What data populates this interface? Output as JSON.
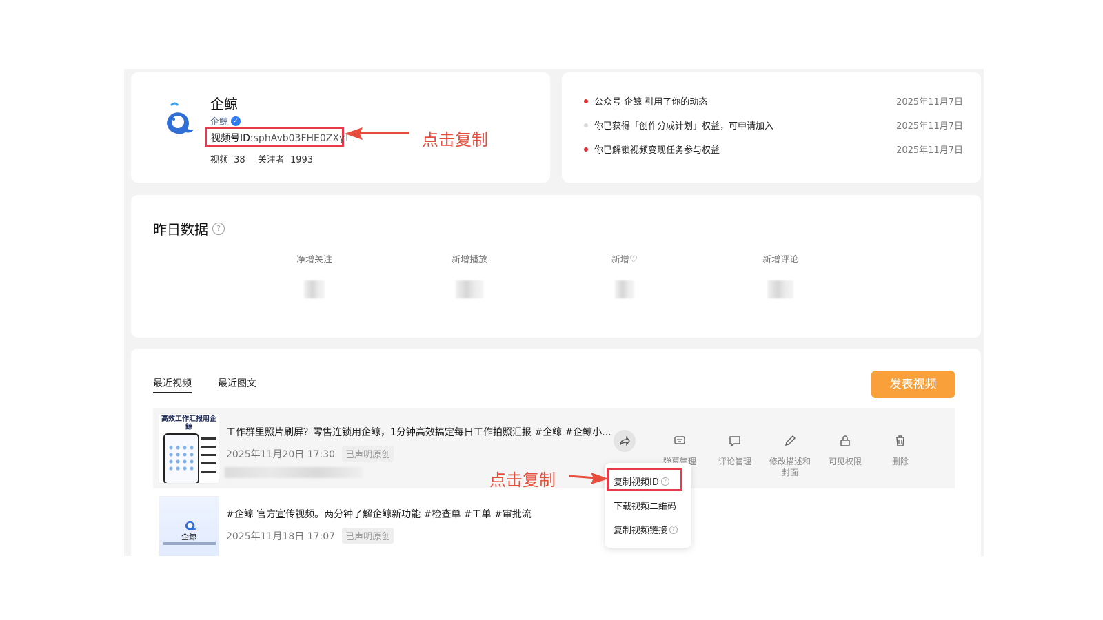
{
  "profile": {
    "name": "企鲸",
    "sub_name": "企鲸",
    "id_label": "视频号ID:",
    "id_value": "sphAvb03FHE0ZXy",
    "videos_label": "视频",
    "videos_count": "38",
    "followers_label": "关注者",
    "followers_count": "1993"
  },
  "notices": [
    {
      "text": "公众号 企鲸 引用了你的动态",
      "date": "2025年11月7日",
      "unread": true
    },
    {
      "text": "你已获得「创作分成计划」权益，可申请加入",
      "date": "2025年11月7日",
      "unread": false
    },
    {
      "text": "你已解锁视频变现任务参与权益",
      "date": "2025年11月7日",
      "unread": true
    }
  ],
  "stats": {
    "title": "昨日数据",
    "items": [
      {
        "label": "净增关注"
      },
      {
        "label": "新增播放"
      },
      {
        "label": "新增"
      },
      {
        "label": "新增评论"
      }
    ]
  },
  "videos_section": {
    "tabs": [
      "最近视频",
      "最近图文"
    ],
    "publish_label": "发表视频",
    "videos": [
      {
        "thumb_title": "高效工作汇报用企鲸",
        "title": "工作群里照片刷屏？零售连锁用企鲸，1分钟高效搞定每日工作拍照汇报 #企鲸 #企鲸小...",
        "date": "2025年11月20日 17:30",
        "badge": "已声明原创"
      },
      {
        "thumb_title": "企鲸",
        "title": "#企鲸 官方宣传视频。两分钟了解企鲸新功能 #检查单 #工单 #审批流",
        "date": "2025年11月18日 17:07",
        "badge": "已声明原创"
      }
    ],
    "actions": [
      {
        "icon": "share-icon",
        "label": ""
      },
      {
        "icon": "danmaku-icon",
        "label": "弹幕管理"
      },
      {
        "icon": "comment-icon",
        "label": "评论管理"
      },
      {
        "icon": "edit-icon",
        "label": "修改描述和封面"
      },
      {
        "icon": "lock-icon",
        "label": "可见权限"
      },
      {
        "icon": "trash-icon",
        "label": "删除"
      }
    ]
  },
  "dropdown": {
    "items": [
      "复制视频ID",
      "下载视频二维码",
      "复制视频链接"
    ]
  },
  "annotations": {
    "top": "点击复制",
    "bottom": "点击复制",
    "color": "#e74c3c"
  }
}
